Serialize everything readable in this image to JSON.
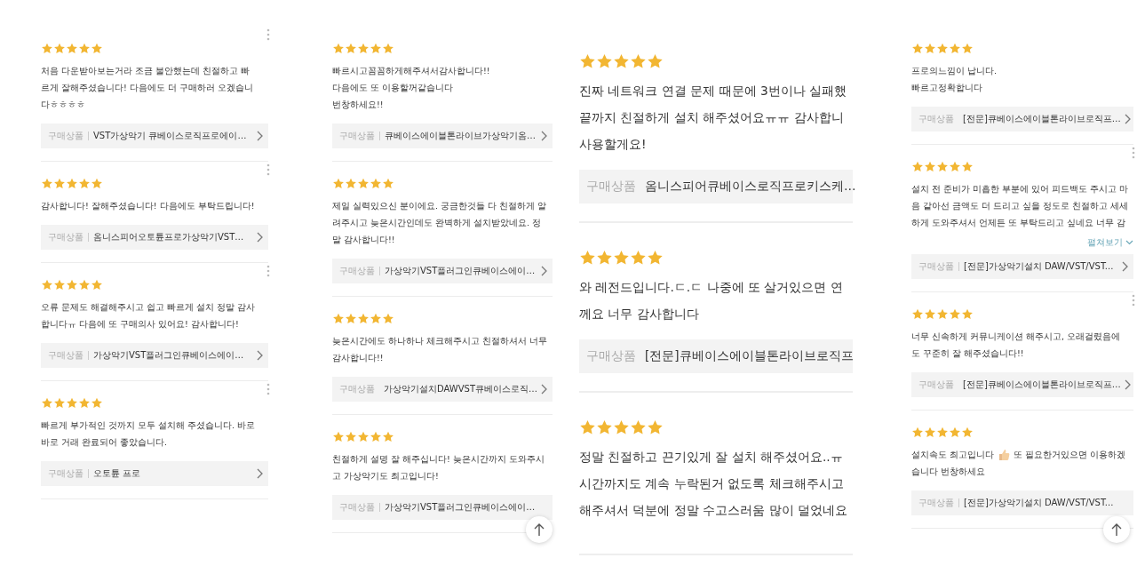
{
  "panels": [
    {
      "scroll_top": false,
      "reviews": [
        {
          "stars": 5,
          "menu": true,
          "body": "처음 다운받아보는거라 조금 불안했는데 친절하고 빠\n르게 잘해주셨습니다! 다음에도 더 구매하러 오겠습니\n다ㅎㅎㅎㅎ",
          "product_label": "구매상품",
          "product": "VST가상악기 큐베이스로직프로에이…",
          "chevron": true
        },
        {
          "stars": 5,
          "menu": true,
          "body": "감사합니다! 잘해주셨습니다! 다음에도 부탁드립니다!",
          "product_label": "구매상품",
          "product": "옴니스피어오토튠프로가상악기VST…",
          "chevron": true
        },
        {
          "stars": 5,
          "menu": true,
          "body": "오류 문제도 해결해주시고 쉽고 빠르게 설치 정말 감사\n합니다ㅠ 다음에 또 구매의사 있어요! 감사합니다!",
          "product_label": "구매상품",
          "product": "가상악기VST플러그인큐베이스에이…",
          "chevron": true
        },
        {
          "stars": 5,
          "menu": true,
          "body": "빠르게 부가적인 것까지 모두 설치해 주셨습니다. 바로\n바로 거래 완료되어 좋았습니다.",
          "product_label": "구매상품",
          "product": "오토튠 프로",
          "chevron": true
        }
      ]
    },
    {
      "scroll_top": true,
      "reviews": [
        {
          "stars": 5,
          "menu": false,
          "body": "빠르시고꼼꼼하게해주셔서감사합니다!!\n다음에도 또 이용할꺼같습니다\n번창하세요!!",
          "product_label": "구매상품",
          "product": "큐베이스에이블톤라이브가상악기옴…",
          "chevron": true
        },
        {
          "stars": 5,
          "menu": false,
          "body": "제일 실력있으신 분이에요. 궁금한것들 다 친절하게 알\n려주시고 늦은시간인데도 완벽하게 설치받았네요. 정\n말 감사합니다!!",
          "product_label": "구매상품",
          "product": "가상악기VST플러그인큐베이스에이…",
          "chevron": true
        },
        {
          "stars": 5,
          "menu": false,
          "body": "늦은시간에도 하나하나 체크해주시고 친절하셔서 너무\n감사합니다!!",
          "product_label": "구매상품",
          "product": "가상악기설치DAWVST큐베이스로직…",
          "chevron": true
        },
        {
          "stars": 5,
          "menu": false,
          "body": "친절하게 설명 잘 해주십니다! 늦은시간까지 도와주시\n고 가상악기도 최고입니다!",
          "product_label": "구매상품",
          "product": "가상악기VST플러그인큐베이스에이…",
          "chevron": false
        }
      ]
    },
    {
      "scroll_top": false,
      "reviews": [
        {
          "stars": 5,
          "menu": false,
          "body": "진짜 네트워크 연결 문제 때문에 3번이나 실패했\n끝까지 친절하게 설치 해주셨어요ㅠㅠ 감사합니\n사용할게요!",
          "product_label": "구매상품",
          "product": "옴니스피어큐베이스로직프로키스케…",
          "chevron": false
        },
        {
          "stars": 5,
          "menu": false,
          "body": "와 레전드입니다.ㄷ.ㄷ 나중에 또 살거있으면 연\n께요 너무 감사합니다",
          "product_label": "구매상품",
          "product": "[전문]큐베이스에이블톤라이브로직프",
          "chevron": false
        },
        {
          "stars": 5,
          "menu": false,
          "body": "정말 친절하고 끈기있게 잘 설치 해주셨어요..ㅠ\n시간까지도 계속 누락된거 없도록 체크해주시고\n해주셔서 덕분에 정말 수고스러움 많이 덜었네요"
        }
      ]
    },
    {
      "scroll_top": true,
      "reviews": [
        {
          "stars": 5,
          "menu": false,
          "body": "프로의느낌이 납니다.\n빠르고정확합니다",
          "product_label": "구매상품",
          "product": "[전문]큐베이스에이블톤라이브로직프…",
          "chevron": true
        },
        {
          "stars": 5,
          "menu": true,
          "body": "설치 전 준비가 미흡한 부분에 있어 피드백도 주시고 마\n음 같아선 금액도 더 드리고 싶을 정도로 친절하고 세세\n하게 도와주셔서 언제든 또 부탁드리고 싶네요 너무 감",
          "more": "펼쳐보기",
          "product_label": "구매상품",
          "product": "[전문]가상악기설치 DAW/VST/VST...",
          "chevron": true
        },
        {
          "stars": 5,
          "menu": true,
          "body": "너무 신속하게 커뮤니케이션 해주시고, 오래걸렸음에\n도 꾸준히 잘 해주셨습니다!!",
          "product_label": "구매상품",
          "product": "[전문]큐베이스에이블톤라이브로직프…",
          "chevron": true
        },
        {
          "stars": 5,
          "menu": false,
          "body": "설치속도 최고입니다",
          "body_after_icon": "또 필요한거있으면 이용하겠",
          "body_continued": "습니다 번창하세요",
          "product_label": "구매상품",
          "product": "[전문]가상악기설치 DAW/VST/VST...",
          "chevron": false
        }
      ]
    }
  ]
}
